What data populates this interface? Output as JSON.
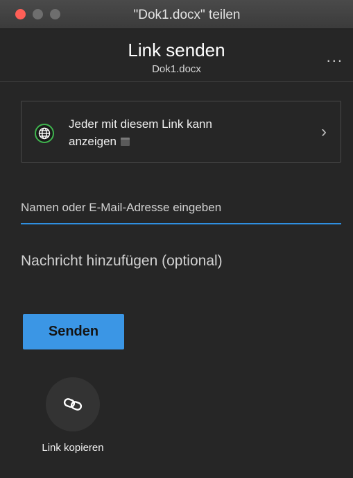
{
  "window": {
    "title": "\"Dok1.docx\" teilen"
  },
  "header": {
    "title": "Link senden",
    "subtitle": "Dok1.docx",
    "more_label": "..."
  },
  "permission": {
    "line1": "Jeder mit diesem Link kann",
    "line2": "anzeigen",
    "chevron": "›"
  },
  "recipient": {
    "placeholder": "Namen oder E-Mail-Adresse eingeben",
    "value": ""
  },
  "message": {
    "placeholder": "Nachricht hinzufügen (optional)",
    "value": ""
  },
  "actions": {
    "send_label": "Senden",
    "copy_link_label": "Link kopieren"
  },
  "colors": {
    "accent": "#3b96e5",
    "globe_ring": "#3fb54e",
    "close_light": "#fe5f57"
  },
  "icons": {
    "globe": "globe-icon",
    "link": "link-icon",
    "calendar": "calendar-icon",
    "chevron": "chevron-right-icon",
    "more": "more-icon"
  }
}
